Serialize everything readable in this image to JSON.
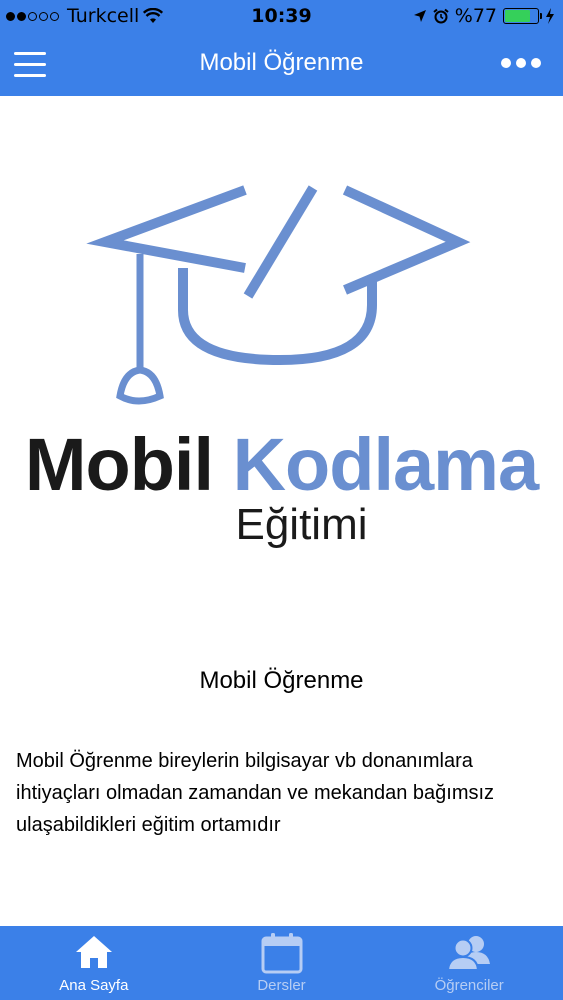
{
  "status_bar": {
    "carrier": "Turkcell",
    "time": "10:39",
    "battery_text": "%77",
    "battery_level": 0.77,
    "signal_bars_filled": 2,
    "signal_bars_total": 5
  },
  "nav": {
    "title": "Mobil Öğrenme"
  },
  "logo": {
    "word1": "Mobil",
    "word2": "Kodlama",
    "subtitle": "Eğitimi"
  },
  "content": {
    "title": "Mobil Öğrenme",
    "body": "Mobil Öğrenme bireylerin bilgisayar vb donanımlara ihtiyaçları olmadan zamandan ve mekandan bağımsız ulaşabildikleri eğitim ortamıdır"
  },
  "tabs": [
    {
      "label": "Ana Sayfa",
      "icon": "home-icon",
      "active": true
    },
    {
      "label": "Dersler",
      "icon": "calendar-icon",
      "active": false
    },
    {
      "label": "Öğrenciler",
      "icon": "users-icon",
      "active": false
    }
  ],
  "colors": {
    "primary": "#3b80e8",
    "logo_blue": "#6a8fd0",
    "battery_green": "#35d05a",
    "tab_inactive": "#b6cdf4"
  }
}
